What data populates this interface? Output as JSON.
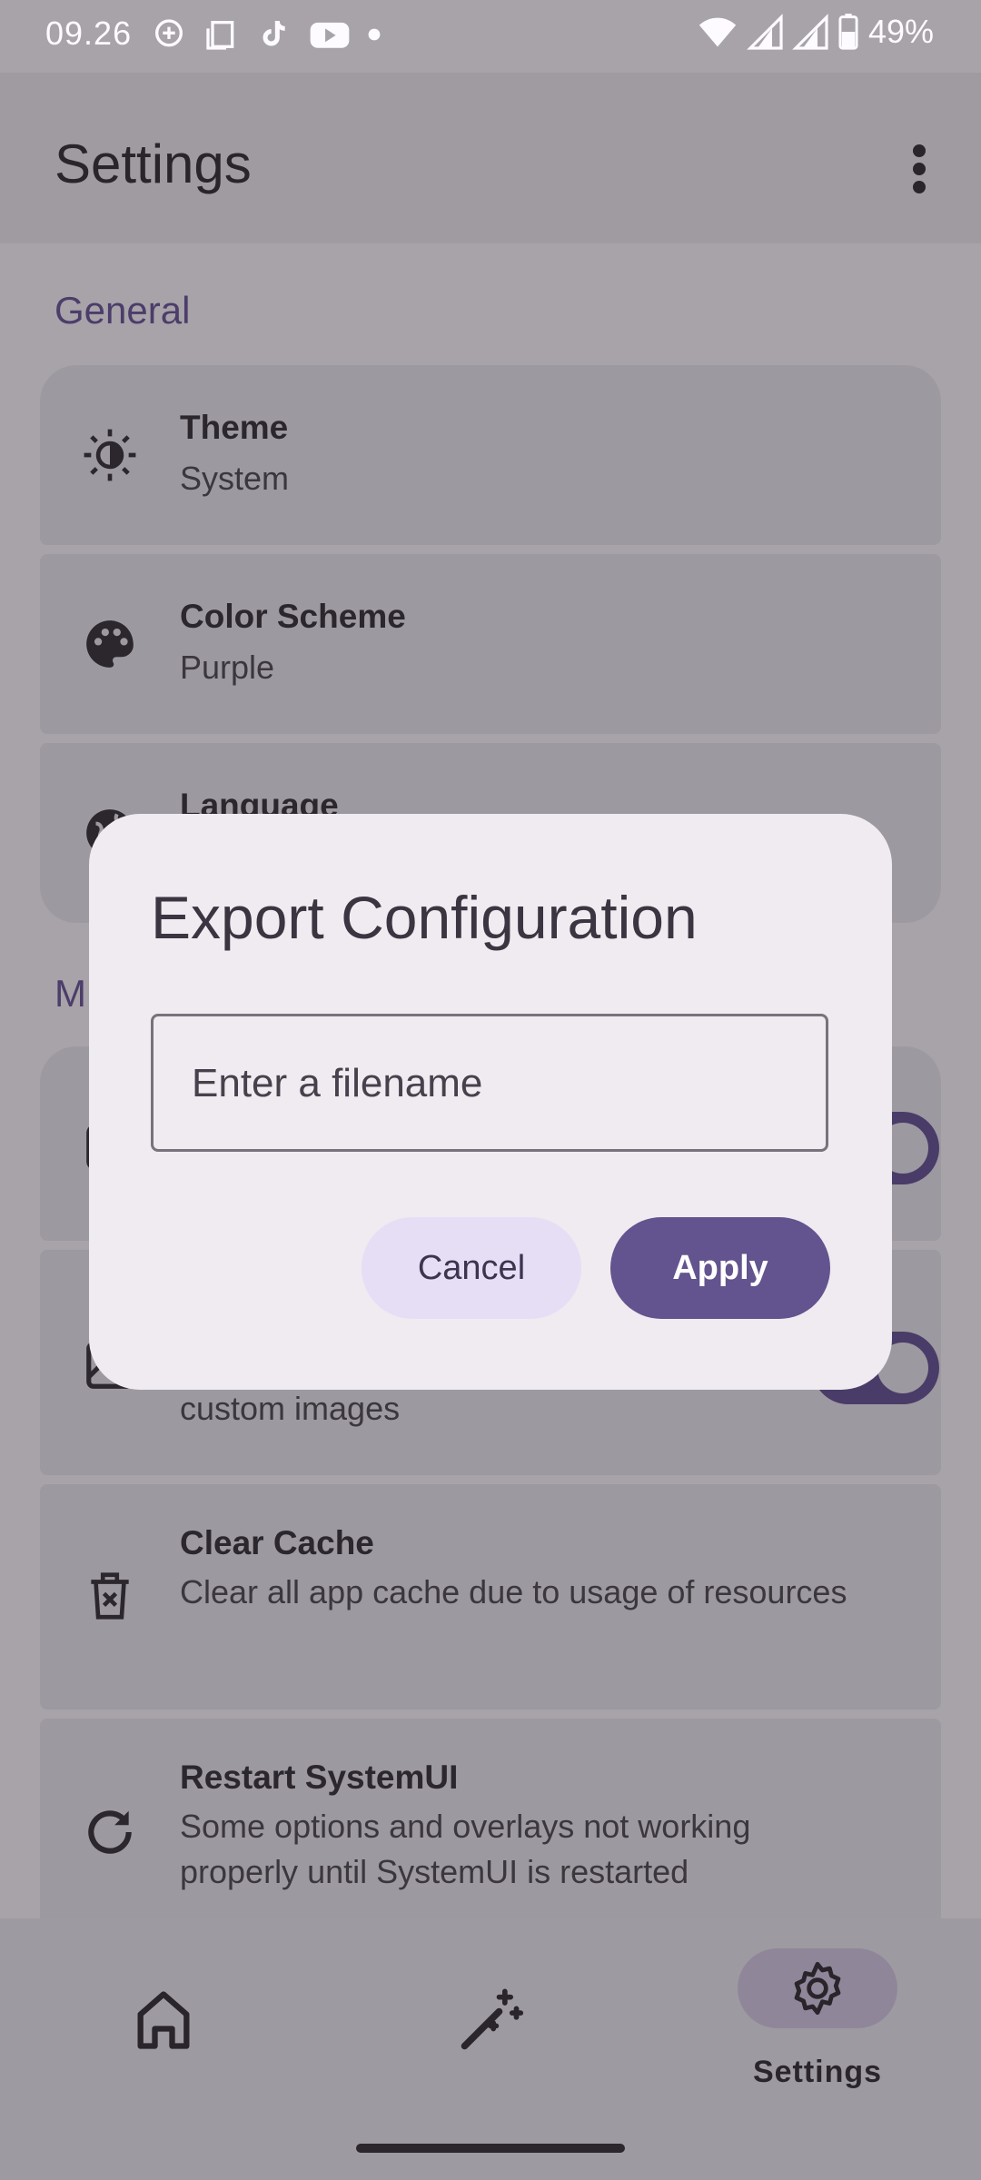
{
  "status_bar": {
    "time": "09.26",
    "battery_percent": "49%",
    "icons": [
      "chat-plus-icon",
      "screenshot-icon",
      "tiktok-icon",
      "youtube-icon",
      "dot-icon",
      "wifi-icon",
      "signal-icon",
      "signal-icon",
      "battery-icon"
    ]
  },
  "header": {
    "title": "Settings"
  },
  "sections": [
    {
      "title": "General"
    },
    {
      "title": "M"
    }
  ],
  "general_items": [
    {
      "title": "Theme",
      "subtitle": "System",
      "icon": "brightness-icon"
    },
    {
      "title": "Color Scheme",
      "subtitle": "Purple",
      "icon": "palette-icon"
    },
    {
      "title": "Language",
      "subtitle": "",
      "icon": "globe-icon"
    }
  ],
  "misc_items": [
    {
      "title": "",
      "subtitle": "custom images",
      "icon": "image-icon",
      "toggle_on": true
    },
    {
      "title": "Clear Cache",
      "subtitle": "Clear all app cache due to usage of resources",
      "icon": "trash-icon"
    },
    {
      "title": "Restart SystemUI",
      "subtitle": "Some options and overlays not working properly until SystemUI is restarted",
      "icon": "restart-icon"
    }
  ],
  "bottom_nav": {
    "items": [
      {
        "label": "",
        "icon": "home-icon"
      },
      {
        "label": "",
        "icon": "magic-wand-icon"
      },
      {
        "label": "Settings",
        "icon": "settings-icon",
        "selected": true
      }
    ]
  },
  "dialog": {
    "title": "Export Configuration",
    "input_placeholder": "Enter a filename",
    "input_value": "",
    "cancel_label": "Cancel",
    "apply_label": "Apply"
  },
  "colors": {
    "accent": "#63538e",
    "tonal": "#e6def5",
    "dialog_surface": "#efebf1"
  }
}
